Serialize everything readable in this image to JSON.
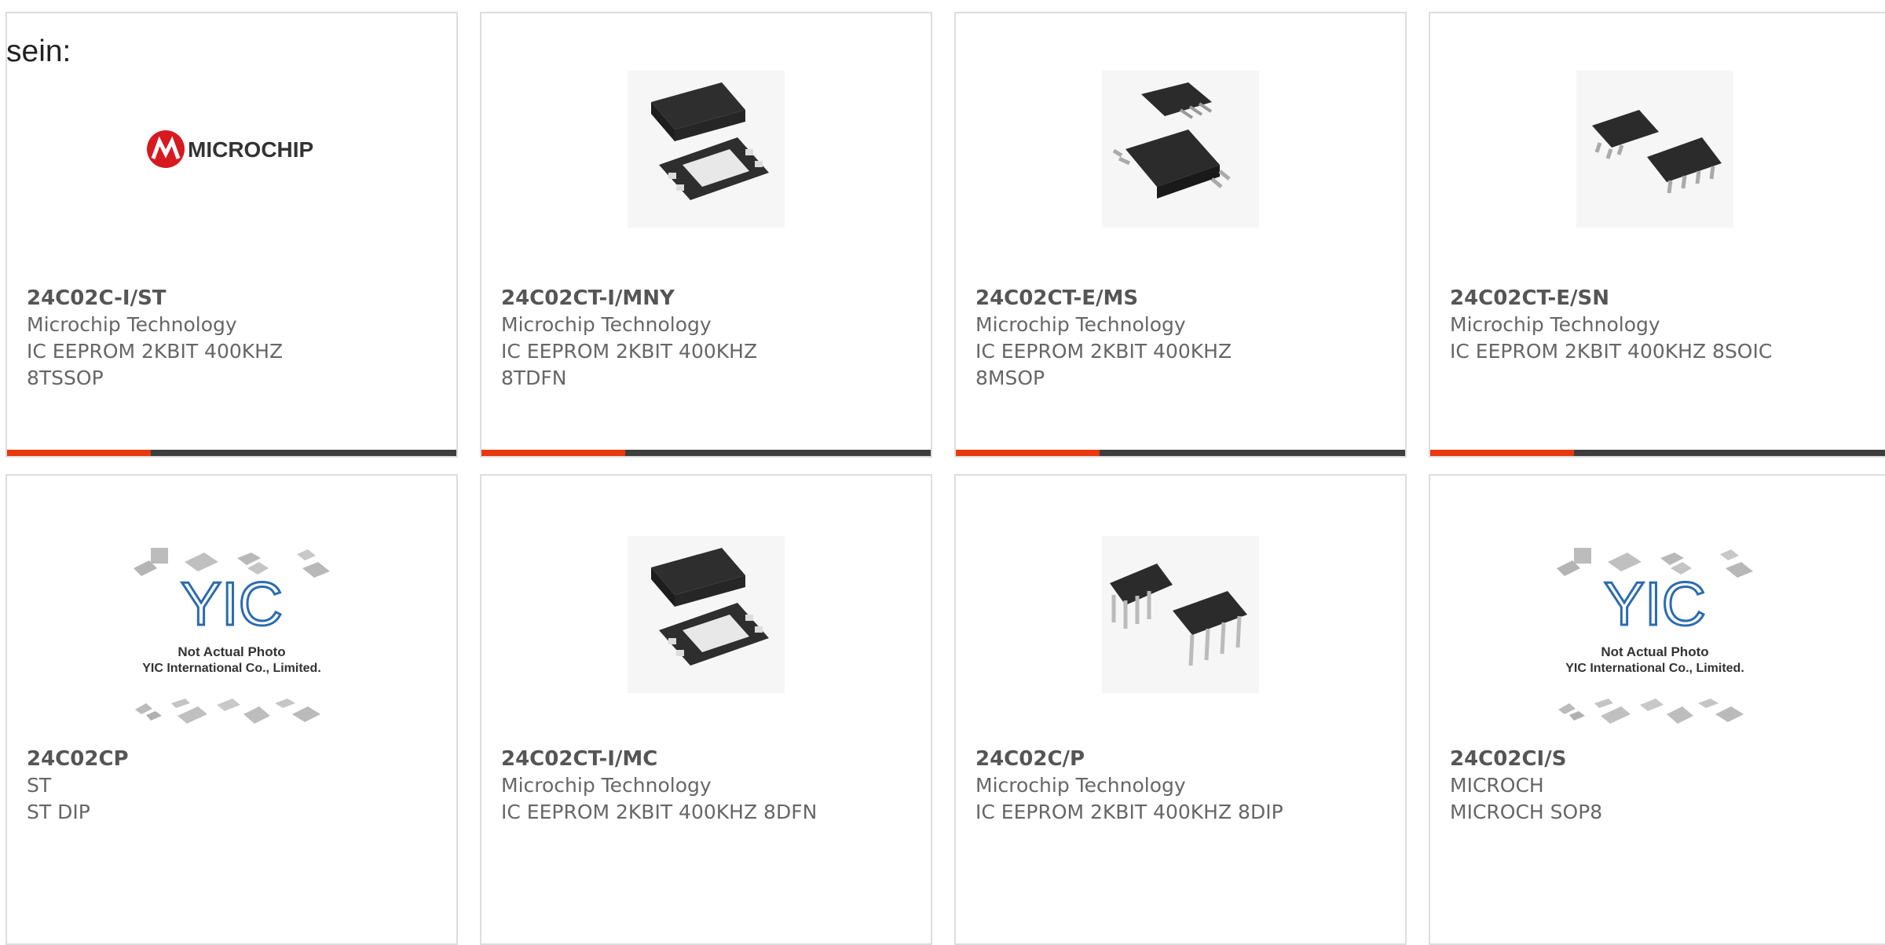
{
  "intro_text": "sein:",
  "accent_color": "#e8380d",
  "products": [
    {
      "part_number": "24C02C-I/ST",
      "manufacturer": "Microchip Technology",
      "desc_1": "IC EEPROM 2KBIT 400KHZ",
      "desc_2": "8TSSOP",
      "image": "microchip-logo",
      "logo_text": "MICROCHIP"
    },
    {
      "part_number": "24C02CT-I/MNY",
      "manufacturer": "Microchip Technology",
      "desc_1": "IC EEPROM 2KBIT 400KHZ",
      "desc_2": "8TDFN",
      "image": "dfn-chip"
    },
    {
      "part_number": "24C02CT-E/MS",
      "manufacturer": "Microchip Technology",
      "desc_1": "IC EEPROM 2KBIT 400KHZ",
      "desc_2": "8MSOP",
      "image": "msop-chip"
    },
    {
      "part_number": "24C02CT-E/SN",
      "manufacturer": "Microchip Technology",
      "desc_1": "IC EEPROM 2KBIT 400KHZ 8SOIC",
      "desc_2": "",
      "image": "soic-chip"
    },
    {
      "part_number": "24C02CP",
      "manufacturer": "ST",
      "desc_1": "ST DIP",
      "desc_2": "",
      "image": "yic-placeholder",
      "ph_text_1": "Not Actual Photo",
      "ph_text_2": "YIC International Co., Limited."
    },
    {
      "part_number": "24C02CT-I/MC",
      "manufacturer": "Microchip Technology",
      "desc_1": "IC EEPROM 2KBIT 400KHZ 8DFN",
      "desc_2": "",
      "image": "dfn-chip"
    },
    {
      "part_number": "24C02C/P",
      "manufacturer": "Microchip Technology",
      "desc_1": "IC EEPROM 2KBIT 400KHZ 8DIP",
      "desc_2": "",
      "image": "dip-chip"
    },
    {
      "part_number": "24C02CI/S",
      "manufacturer": "MICROCH",
      "desc_1": "MICROCH SOP8",
      "desc_2": "",
      "image": "yic-placeholder",
      "ph_text_1": "Not Actual Photo",
      "ph_text_2": "YIC International Co., Limited."
    }
  ]
}
